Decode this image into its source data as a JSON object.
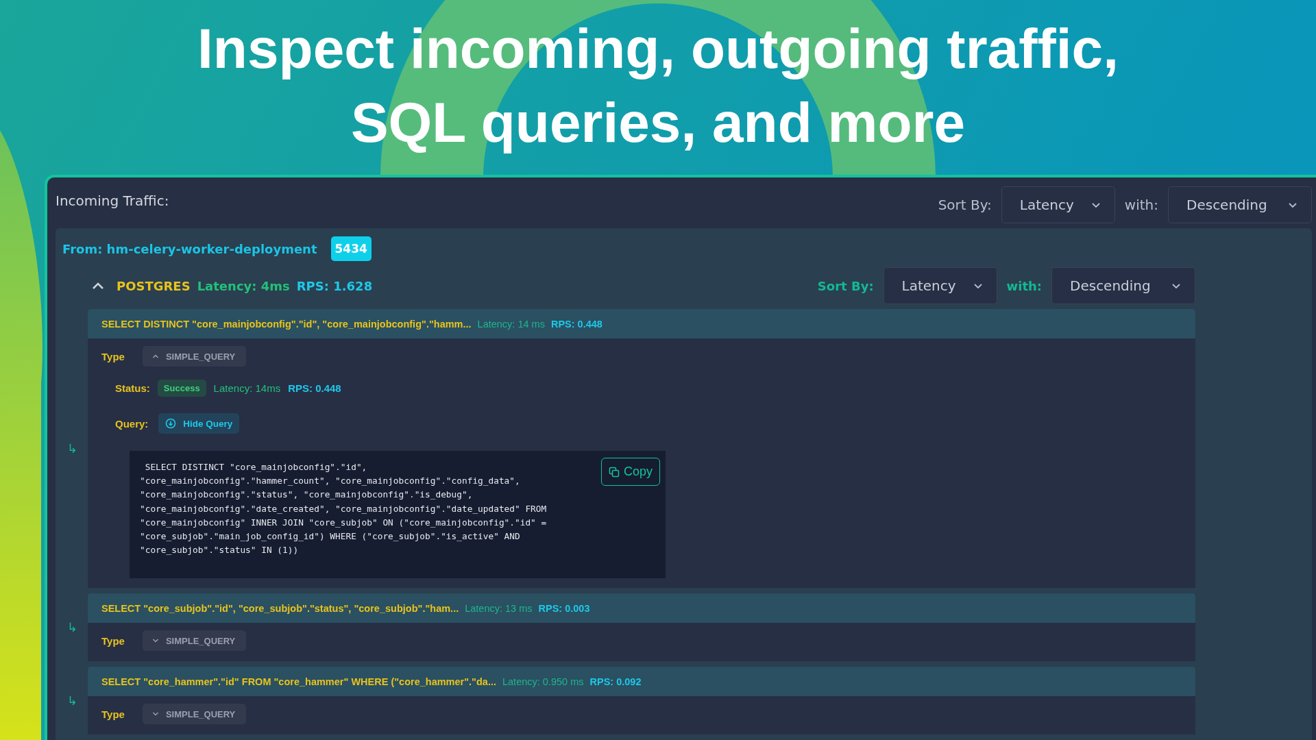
{
  "headline": [
    "Inspect incoming, outgoing traffic,",
    "SQL queries, and more"
  ],
  "panel": {
    "title": "Incoming Traffic:",
    "sort_label": "Sort By:",
    "sort_value": "Latency",
    "with_label": "with:",
    "order_value": "Descending"
  },
  "source": {
    "from": "From: hm-celery-worker-deployment",
    "port": "5434"
  },
  "service": {
    "expanded": true,
    "name": "POSTGRES",
    "latency": "Latency: 4ms",
    "rps": "RPS: 1.628",
    "sort_label": "Sort By:",
    "sort_value": "Latency",
    "with_label": "with:",
    "order_value": "Descending"
  },
  "queries": [
    {
      "marker": "↳",
      "title": "SELECT DISTINCT \"core_mainjobconfig\".\"id\", \"core_mainjobconfig\".\"hamm...",
      "latency": "Latency: 14 ms",
      "rps": "RPS: 0.448",
      "type_label": "Type",
      "type": "SIMPLE_QUERY",
      "expanded": true,
      "status_label": "Status:",
      "status": "Success",
      "detail_latency": "Latency: 14ms",
      "detail_rps": "RPS: 0.448",
      "query_label": "Query:",
      "toggle": "Hide Query",
      "copy": "Copy",
      "code": [
        " SELECT DISTINCT \"core_mainjobconfig\".\"id\",",
        "\"core_mainjobconfig\".\"hammer_count\", \"core_mainjobconfig\".\"config_data\",",
        "\"core_mainjobconfig\".\"status\", \"core_mainjobconfig\".\"is_debug\",",
        "\"core_mainjobconfig\".\"date_created\", \"core_mainjobconfig\".\"date_updated\" FROM",
        "\"core_mainjobconfig\" INNER JOIN \"core_subjob\" ON (\"core_mainjobconfig\".\"id\" =",
        "\"core_subjob\".\"main_job_config_id\") WHERE (\"core_subjob\".\"is_active\" AND",
        "\"core_subjob\".\"status\" IN (1))"
      ]
    },
    {
      "marker": "↳",
      "title": "SELECT \"core_subjob\".\"id\", \"core_subjob\".\"status\", \"core_subjob\".\"ham...",
      "latency": "Latency: 13 ms",
      "rps": "RPS: 0.003",
      "type_label": "Type",
      "type": "SIMPLE_QUERY",
      "expanded": false
    },
    {
      "marker": "↳",
      "title": "SELECT \"core_hammer\".\"id\" FROM \"core_hammer\" WHERE (\"core_hammer\".\"da...",
      "latency": "Latency: 0.950 ms",
      "rps": "RPS: 0.092",
      "type_label": "Type",
      "type": "SIMPLE_QUERY",
      "expanded": false
    }
  ]
}
